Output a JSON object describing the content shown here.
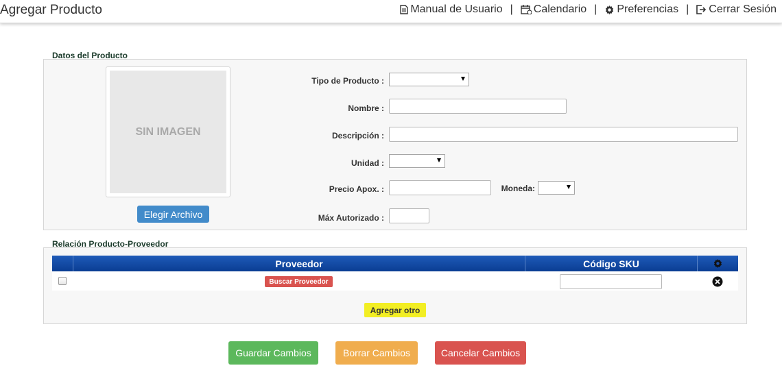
{
  "header": {
    "title": "Agregar Producto",
    "nav": {
      "manual": "Manual de Usuario",
      "calendar": "Calendario",
      "preferences": "Preferencias",
      "logout": "Cerrar Sesión",
      "separator": "|"
    }
  },
  "product": {
    "legend": "Datos del Producto",
    "image_placeholder": "SIN IMAGEN",
    "choose_file": "Elegir Archivo",
    "labels": {
      "type": "Tipo de Producto :",
      "name": "Nombre :",
      "description": "Descripción :",
      "unit": "Unidad :",
      "price": "Precio Apox. :",
      "currency": "Moneda:",
      "max": "Máx Autorizado :"
    },
    "values": {
      "type": "",
      "name": "",
      "description": "",
      "unit": "",
      "price": "",
      "currency": "",
      "max": ""
    }
  },
  "supplier": {
    "legend": "Relación Producto-Proveedor",
    "columns": {
      "supplier": "Proveedor",
      "sku": "Código SKU"
    },
    "row": {
      "search_button": "Buscar Proveedor",
      "sku": ""
    },
    "add_another": "Agregar otro"
  },
  "actions": {
    "save": "Guardar Cambios",
    "clear": "Borrar Cambios",
    "cancel": "Cancelar Cambios"
  },
  "colors": {
    "header_blue": "#0a3d93",
    "save_green": "#5cb85c",
    "clear_orange": "#f0ad4e",
    "cancel_red": "#d9534f",
    "choose_blue": "#428bca",
    "yellow": "#f2ee24"
  }
}
